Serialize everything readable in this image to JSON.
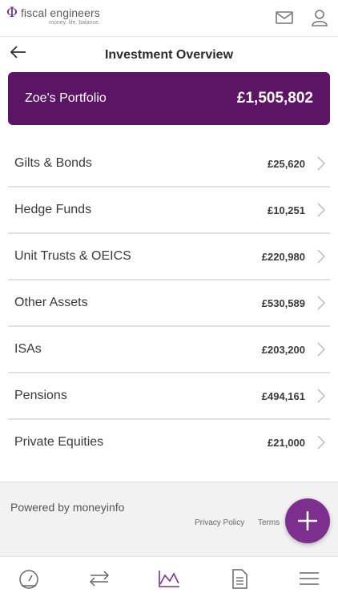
{
  "header": {
    "brand_name": "fiscal engineers",
    "tagline": "money. life. balance.",
    "mail_icon": "mail-icon",
    "user_icon": "user-icon"
  },
  "page": {
    "title": "Investment Overview",
    "back_icon": "arrow-left-icon"
  },
  "portfolio": {
    "name": "Zoe's Portfolio",
    "total": "£1,505,802",
    "color": "#5c1565"
  },
  "accounts": [
    {
      "label": "Gilts & Bonds",
      "value": "£25,620"
    },
    {
      "label": "Hedge Funds",
      "value": "£10,251"
    },
    {
      "label": "Unit Trusts & OEICS",
      "value": "£220,980"
    },
    {
      "label": "Other Assets",
      "value": "£530,589"
    },
    {
      "label": "ISAs",
      "value": "£203,200"
    },
    {
      "label": "Pensions",
      "value": "£494,161"
    },
    {
      "label": "Private Equities",
      "value": "£21,000"
    }
  ],
  "footer": {
    "powered_by": "Powered by moneyinfo",
    "privacy": "Privacy Policy",
    "terms": "Terms"
  },
  "fab": {
    "icon": "plus-icon",
    "color": "#7d2f8d"
  },
  "bottom_nav": {
    "items": [
      {
        "icon": "dashboard-gauge-icon",
        "active": false
      },
      {
        "icon": "transfer-arrows-icon",
        "active": false
      },
      {
        "icon": "area-chart-icon",
        "active": true
      },
      {
        "icon": "document-icon",
        "active": false
      },
      {
        "icon": "hamburger-menu-icon",
        "active": false
      }
    ],
    "active_color": "#7d2f8d"
  }
}
